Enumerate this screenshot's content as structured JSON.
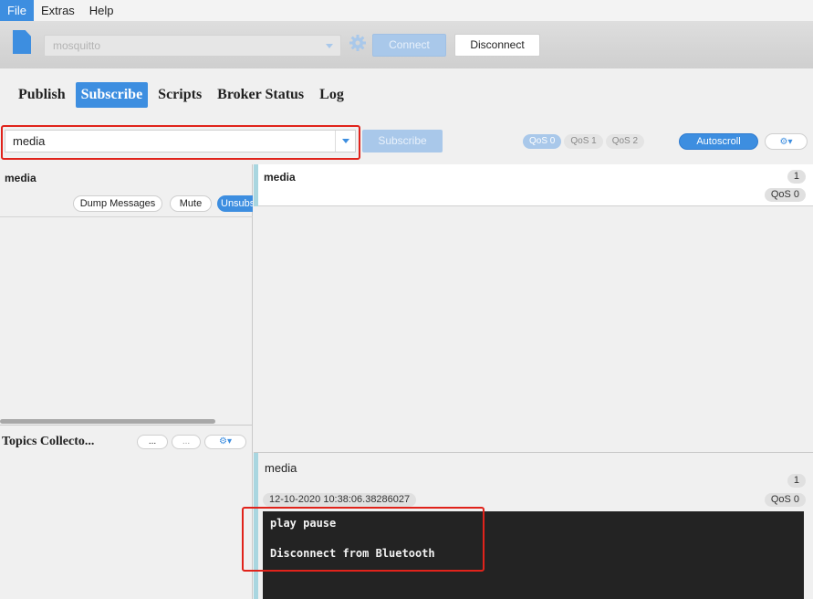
{
  "menu": {
    "items": [
      "File",
      "Extras",
      "Help"
    ]
  },
  "connection": {
    "profile": "mosquitto",
    "connect_label": "Connect",
    "disconnect_label": "Disconnect"
  },
  "tabs": [
    "Publish",
    "Subscribe",
    "Scripts",
    "Broker Status",
    "Log"
  ],
  "subscribe_bar": {
    "topic_value": "media",
    "subscribe_label": "Subscribe",
    "qos": [
      "QoS 0",
      "QoS 1",
      "QoS 2"
    ],
    "autoscroll_label": "Autoscroll",
    "settings_icon": "gears-dropdown-icon"
  },
  "subscriptions": {
    "topic": "media",
    "dump_label": "Dump Messages",
    "mute_label": "Mute",
    "unsub_label": "Unsubscribe"
  },
  "topics_collector": {
    "title": "Topics Collecto...",
    "btn1": "...",
    "btn2": "..."
  },
  "messages": [
    {
      "topic": "media",
      "count": "1",
      "qos": "QoS 0"
    }
  ],
  "detail": {
    "topic": "media",
    "count": "1",
    "timestamp": "12-10-2020  10:38:06.38286027",
    "qos": "QoS 0",
    "payload_lines": [
      "play pause",
      "Disconnect from Bluetooth"
    ]
  },
  "colors": {
    "accent": "#3d8ee0",
    "accent_disabled": "#a9c8ea",
    "highlight": "#e0231b",
    "payload_bg": "#232323"
  }
}
